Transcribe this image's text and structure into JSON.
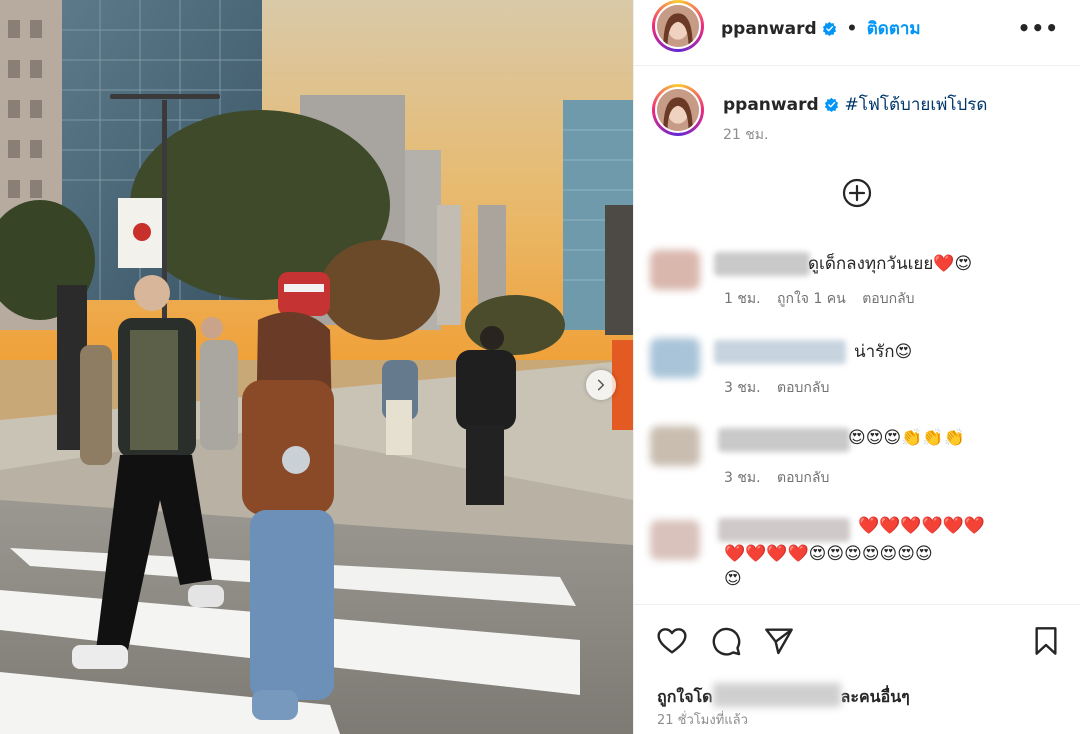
{
  "photo": {
    "alt_icon": "chevron-right-icon"
  },
  "header": {
    "username": "ppanward",
    "separator": "•",
    "follow_label": "ติดตาม",
    "more_label": "•••"
  },
  "caption": {
    "username": "ppanward",
    "text": "#โฟโต้บายเพ่โปรด",
    "time": "21 ชม."
  },
  "comments": [
    {
      "text": "ดูเด็กลงทุกวันเยย❤️😍",
      "time": "1 ชม.",
      "likes": "ถูกใจ 1 คน",
      "reply": "ตอบกลับ"
    },
    {
      "text": "น่ารัก😍",
      "time": "3 ชม.",
      "reply": "ตอบกลับ"
    },
    {
      "text": "😍😍😍👏👏👏",
      "time": "3 ชม.",
      "reply": "ตอบกลับ"
    },
    {
      "text_line1": "❤️❤️❤️❤️❤️❤️",
      "text_line2": "❤️❤️❤️❤️😍😍😍😍😍😍😍",
      "text_line3": "😍"
    }
  ],
  "footer": {
    "liked_by_prefix": "ถูกใจโด",
    "liked_by_suffix": "ละคนอื่นๆ",
    "post_time": "21 ชั่วโมงที่แล้ว"
  },
  "colors": {
    "link": "#0095f6",
    "hashtag": "#00376b",
    "muted": "#8e8e8e"
  }
}
